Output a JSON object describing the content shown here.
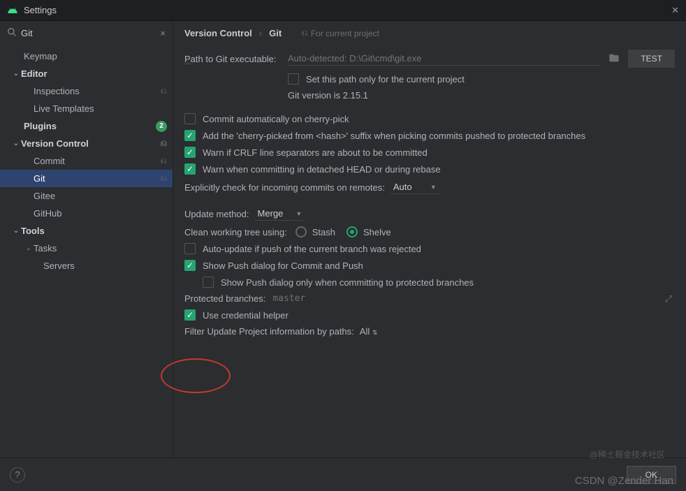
{
  "window": {
    "title": "Settings"
  },
  "search": {
    "value": "Git"
  },
  "tree": {
    "keymap": "Keymap",
    "editor": "Editor",
    "inspections": "Inspections",
    "live_templates": "Live Templates",
    "plugins": "Plugins",
    "plugins_badge": "2",
    "version_control": "Version Control",
    "commit": "Commit",
    "git": "Git",
    "gitee": "Gitee",
    "github": "GitHub",
    "tools": "Tools",
    "tasks": "Tasks",
    "servers": "Servers"
  },
  "breadcrumb": {
    "a": "Version Control",
    "b": "Git",
    "note": "For current project"
  },
  "path": {
    "label": "Path to Git executable:",
    "placeholder": "Auto-detected: D:\\Git\\cmd\\git.exe",
    "test": "TEST"
  },
  "opts": {
    "set_path_current": "Set this path only for the current project",
    "version": "Git version is 2.15.1",
    "commit_auto_cherry": "Commit automatically on cherry-pick",
    "add_cherry_suffix": "Add the 'cherry-picked from <hash>' suffix when picking commits pushed to protected branches",
    "warn_crlf": "Warn if CRLF line separators are about to be committed",
    "warn_detached": "Warn when committing in detached HEAD or during rebase",
    "explicit_check": "Explicitly check for incoming commits on remotes:",
    "explicit_val": "Auto",
    "update_method": "Update method:",
    "update_val": "Merge",
    "clean_tree": "Clean working tree using:",
    "stash": "Stash",
    "shelve": "Shelve",
    "auto_update_push": "Auto-update if push of the current branch was rejected",
    "show_push_dialog": "Show Push dialog for Commit and Push",
    "show_push_protected": "Show Push dialog only when committing to protected branches",
    "protected_label": "Protected branches:",
    "protected_val": "master",
    "use_cred_helper": "Use credential helper",
    "filter_update": "Filter Update Project information by paths:",
    "filter_val": "All"
  },
  "footer": {
    "ok": "OK"
  },
  "watermark1": "@稀土掘金技术社区",
  "watermark2": "CSDN @Zender Han"
}
